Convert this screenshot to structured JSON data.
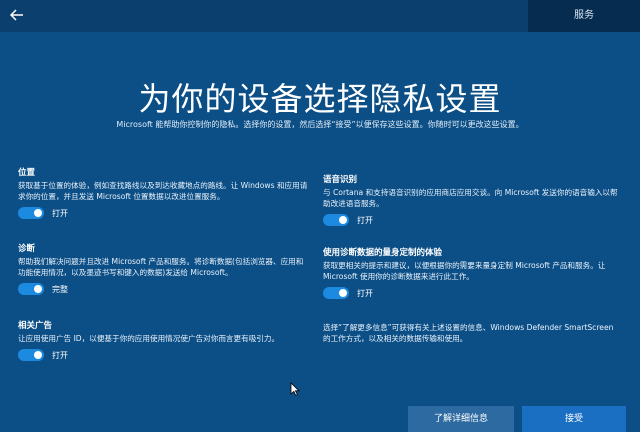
{
  "topbar": {
    "back_icon": "back-arrow-icon",
    "service_tab": "服务"
  },
  "title": "为你的设备选择隐私设置",
  "subtitle": "Microsoft 能帮助你控制你的隐私。选择你的设置，然后选择“接受”以便保存这些设置。你随时可以更改这些设置。",
  "settings": {
    "location": {
      "name": "位置",
      "desc": "获取基于位置的体验，例如查找路线以及到达收藏地点的路线。让 Windows 和应用请求你的位置，并且发送 Microsoft 位置数据以改进位置服务。",
      "state": "打开",
      "on": true
    },
    "diagnostics": {
      "name": "诊断",
      "desc": "帮助我们解决问题并且改进 Microsoft 产品和服务。将诊断数据(包括浏览器、应用和功能使用情况，以及墨迹书写和键入的数据)发送给 Microsoft。",
      "state": "完整",
      "on": true
    },
    "ads": {
      "name": "相关广告",
      "desc": "让应用使用广告 ID，以便基于你的应用使用情况使广告对你而言更有吸引力。",
      "state": "打开",
      "on": true
    },
    "speech": {
      "name": "语音识别",
      "desc": "与 Cortana 和支持语音识别的应用商店应用交谈。向 Microsoft 发送你的语音输入以帮助改进语音服务。",
      "state": "打开",
      "on": true
    },
    "tailored": {
      "name": "使用诊断数据的量身定制的体验",
      "desc": "获取更相关的提示和建议，以便根据你的需要来量身定制 Microsoft 产品和服务。让 Microsoft 使用你的诊断数据来进行此工作。",
      "state": "打开",
      "on": true
    }
  },
  "info_text": "选择“了解更多信息”可获得有关上述设置的信息、Windows Defender SmartScreen 的工作方式，以及相关的数据传输和使用。",
  "buttons": {
    "details": "了解详细信息",
    "accept": "接受"
  },
  "colors": {
    "background": "#0c4f87",
    "toggle_on": "#1c8ae0",
    "accept_button": "#1b6fc2"
  }
}
